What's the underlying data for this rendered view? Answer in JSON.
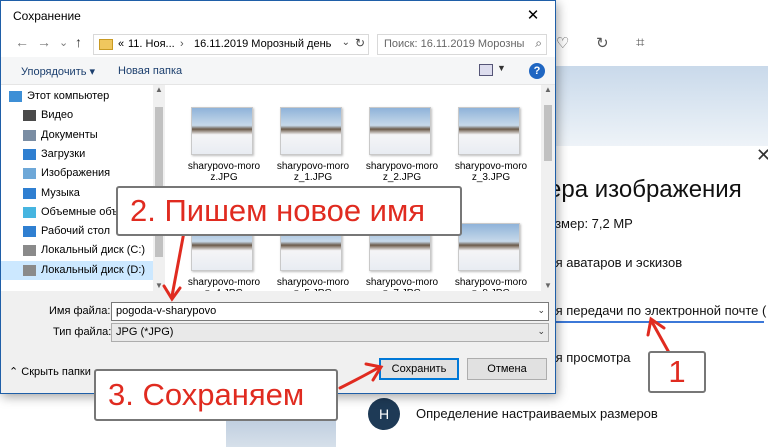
{
  "background": {
    "panel_title": "ера изображения",
    "size_text": "азмер: 7,2 MP",
    "options": [
      "ля аватаров и эскизов",
      "ля передачи по электронной почте (",
      "ля просмотра"
    ],
    "custom_avatar": "Н",
    "custom_label": "Определение настраиваемых размеров",
    "close_glyph": "✕",
    "icons": [
      "heart-icon",
      "rotate-icon",
      "crop-icon"
    ]
  },
  "dialog": {
    "title": "Сохранение",
    "close_glyph": "✕",
    "nav": {
      "back": "←",
      "forward": "→",
      "dropdown": "⌄",
      "up": "↑"
    },
    "address": {
      "prefix": "«",
      "crumbs": [
        "11. Ноя...",
        "16.11.2019 Морозный день"
      ],
      "separator": "›"
    },
    "search_placeholder": "Поиск: 16.11.2019 Морозный...",
    "toolbar": {
      "organize": "Упорядочить ▾",
      "new_folder": "Новая папка",
      "help": "?"
    },
    "tree": [
      {
        "label": "Этот компьютер",
        "icon": "computer-icon",
        "color": "#3d8fd6"
      },
      {
        "label": "Видео",
        "icon": "video-folder-icon",
        "color": "#4a4a4a"
      },
      {
        "label": "Документы",
        "icon": "documents-folder-icon",
        "color": "#7a8da3"
      },
      {
        "label": "Загрузки",
        "icon": "downloads-folder-icon",
        "color": "#2f7fd1"
      },
      {
        "label": "Изображения",
        "icon": "pictures-folder-icon",
        "color": "#6ea8d8"
      },
      {
        "label": "Музыка",
        "icon": "music-folder-icon",
        "color": "#2f7fd1"
      },
      {
        "label": "Объемные объекты",
        "icon": "3d-objects-icon",
        "color": "#46b5e0"
      },
      {
        "label": "Рабочий стол",
        "icon": "desktop-folder-icon",
        "color": "#2f7fd1"
      },
      {
        "label": "Локальный диск (C:)",
        "icon": "drive-c-icon",
        "color": "#8a8a8a"
      },
      {
        "label": "Локальный диск (D:)",
        "icon": "drive-d-icon",
        "color": "#8a8a8a"
      }
    ],
    "files": [
      {
        "line1": "sharypovo-moro",
        "line2": "z.JPG"
      },
      {
        "line1": "sharypovo-moro",
        "line2": "z_1.JPG"
      },
      {
        "line1": "sharypovo-moro",
        "line2": "z_2.JPG"
      },
      {
        "line1": "sharypovo-moro",
        "line2": "z_3.JPG"
      },
      {
        "line1": "sharypovo-moro",
        "line2": "z_4.JPG"
      },
      {
        "line1": "sharypovo-moro",
        "line2": "z_5.JPG"
      },
      {
        "line1": "sharypovo-moro",
        "line2": "z_7.JPG"
      },
      {
        "line1": "sharypovo-moro",
        "line2": "z_8.JPG"
      }
    ],
    "filename_label": "Имя файла:",
    "filename_value": "pogoda-v-sharypovo",
    "filetype_label": "Тип файла:",
    "filetype_value": "JPG (*JPG)",
    "hide_folders": "Скрыть папки",
    "save_button": "Сохранить",
    "cancel_button": "Отмена"
  },
  "annotations": {
    "step1": "1",
    "step2": "2. Пишем новое имя",
    "step3": "3. Сохраняем",
    "color": "#e02b20"
  }
}
